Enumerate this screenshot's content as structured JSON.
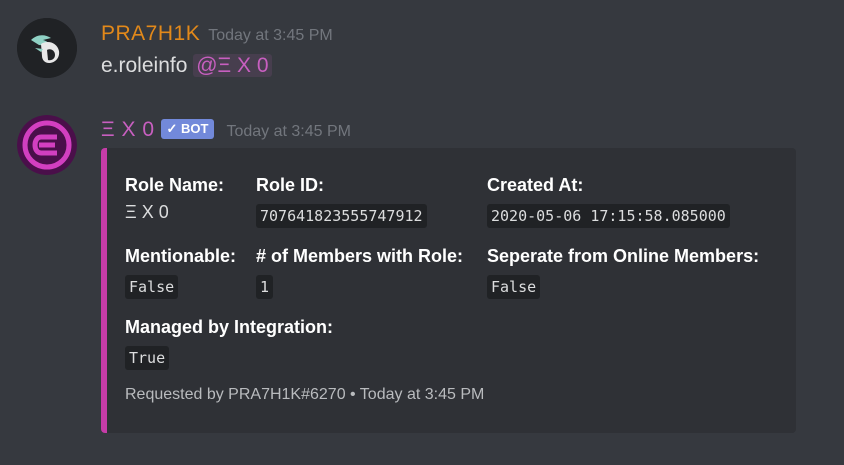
{
  "colors": {
    "background": "#36393f",
    "embed_accent": "#c63ca8",
    "user_name": "#e3891a",
    "bot_name": "#c85fc0",
    "bot_tag": "#7289da"
  },
  "messages": [
    {
      "author": "PRA7H1K",
      "timestamp": "Today at 3:45 PM",
      "avatar_icon": "winged-helmet-icon",
      "text": "e.roleinfo",
      "mention": "@Ξ X 0"
    },
    {
      "author": "Ξ X 0",
      "bot_tag": "✓ BOT",
      "timestamp": "Today at 3:45 PM",
      "avatar_icon": "purple-e-logo-icon",
      "embed": {
        "fields": [
          {
            "name": "Role Name:",
            "value": "Ξ X 0",
            "code": false
          },
          {
            "name": "Role ID:",
            "value": "707641823555747912",
            "code": true
          },
          {
            "name": "Created At:",
            "value": "2020-05-06 17:15:58.085000",
            "code": true
          },
          {
            "name": "Mentionable:",
            "value": "False",
            "code": true
          },
          {
            "name": "# of Members with Role:",
            "value": "1",
            "code": true
          },
          {
            "name": "Seperate from Online Members:",
            "value": "False",
            "code": true
          },
          {
            "name": "Managed by Integration:",
            "value": "True",
            "code": true
          }
        ],
        "footer": "Requested by PRA7H1K#6270 • Today at 3:45 PM"
      }
    }
  ]
}
